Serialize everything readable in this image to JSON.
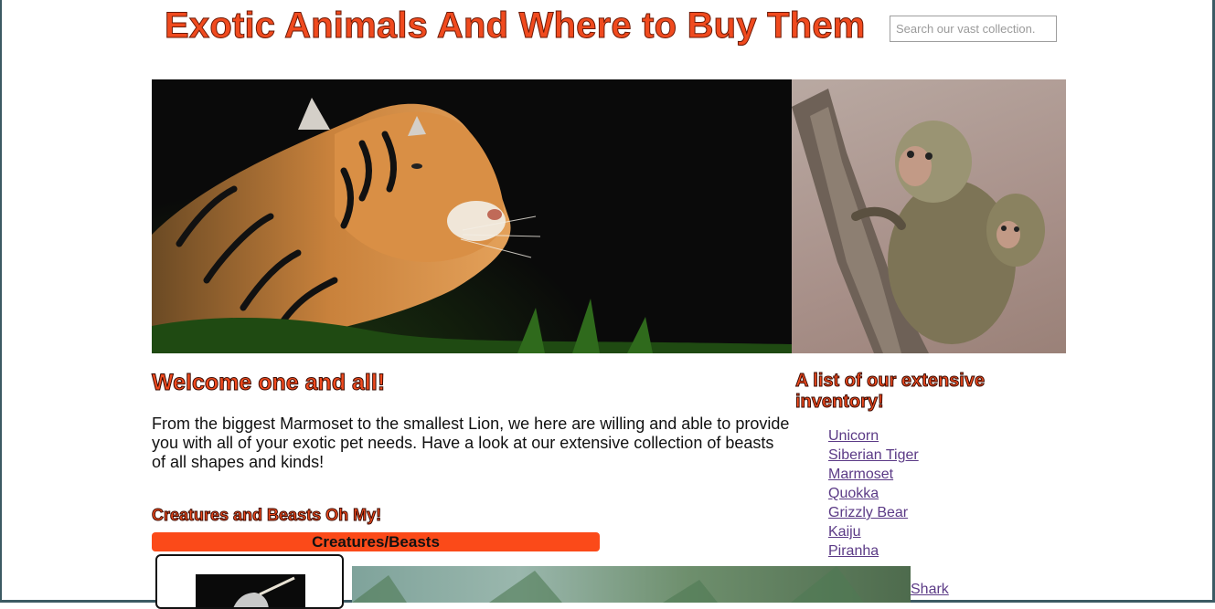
{
  "header": {
    "title": "Exotic Animals And Where to Buy Them",
    "search_placeholder": "Search our vast collection."
  },
  "hero": {
    "main_image": "tiger-photo",
    "side_image": "marmoset-photo"
  },
  "welcome": {
    "heading": "Welcome one and all!",
    "body": "From the biggest Marmoset to the smallest Lion, we here are willing and able to provide you with all of your exotic pet needs. Have a look at our extensive collection of beasts of all shapes and kinds!"
  },
  "creatures": {
    "heading": "Creatures and Beasts Oh My!",
    "table_header": "Creatures/Beasts"
  },
  "inventory": {
    "heading": "A list of our extensive inventory!",
    "items": [
      "Unicorn",
      "Siberian Tiger",
      "Marmoset",
      "Quokka",
      "Grizzly Bear",
      "Kaiju",
      "Piranha"
    ],
    "partially_visible": "Shark"
  },
  "colors": {
    "accent": "#f04a1e",
    "table_header": "#fb4a19",
    "link": "#5b3a86",
    "frame": "#3c5a63"
  }
}
